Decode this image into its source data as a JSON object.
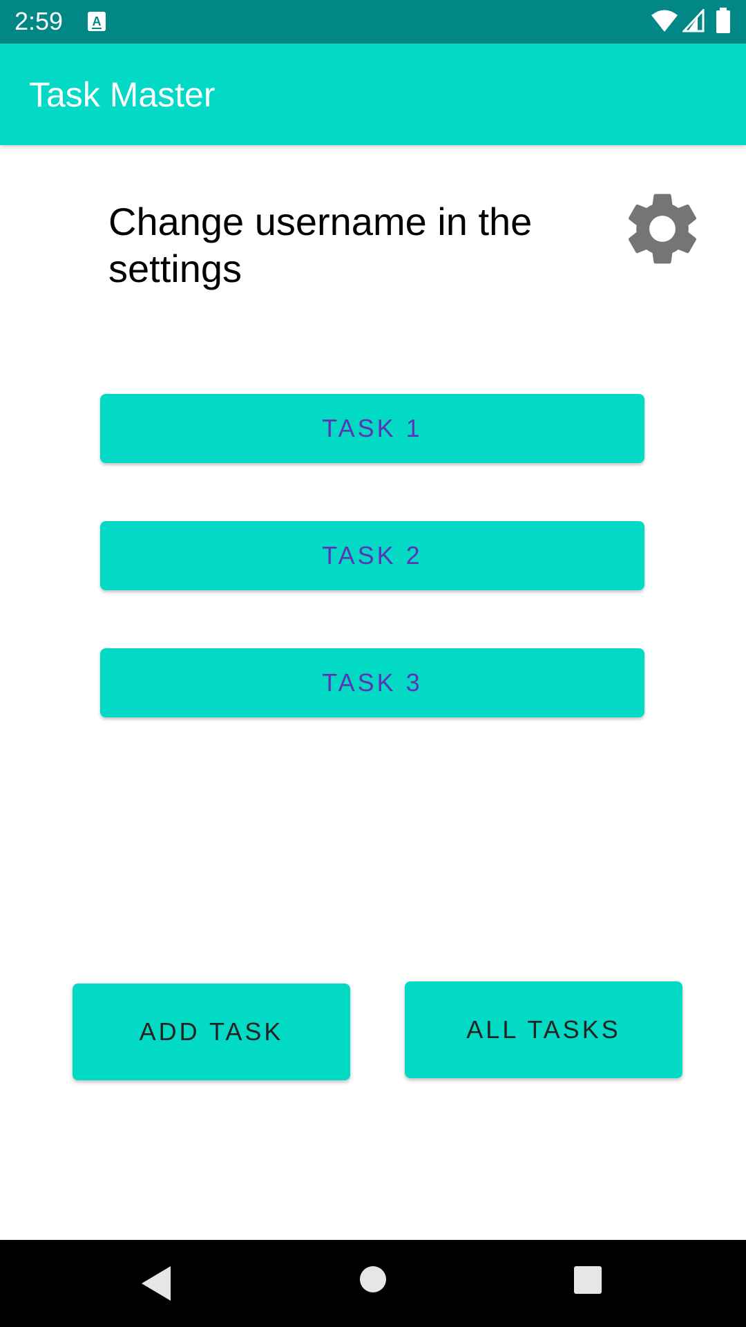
{
  "status_bar": {
    "time": "2:59",
    "notification_icon": "text-input-icon",
    "wifi_icon": "wifi-icon",
    "signal_icon": "cell-signal-icon",
    "battery_icon": "battery-icon",
    "color": "#018786"
  },
  "app_bar": {
    "title": "Task Master",
    "color": "#03DAC5"
  },
  "main": {
    "greeting": "Change username in the settings",
    "settings_icon": "gear-icon",
    "tasks": [
      {
        "label": "TASK 1"
      },
      {
        "label": "TASK 2"
      },
      {
        "label": "TASK 3"
      }
    ],
    "task_text_color": "#5b34b8"
  },
  "actions": {
    "add_task_label": "ADD TASK",
    "all_tasks_label": "ALL TASKS"
  },
  "nav_bar": {
    "back_icon": "back-triangle-icon",
    "home_icon": "home-circle-icon",
    "recents_icon": "recents-square-icon"
  }
}
